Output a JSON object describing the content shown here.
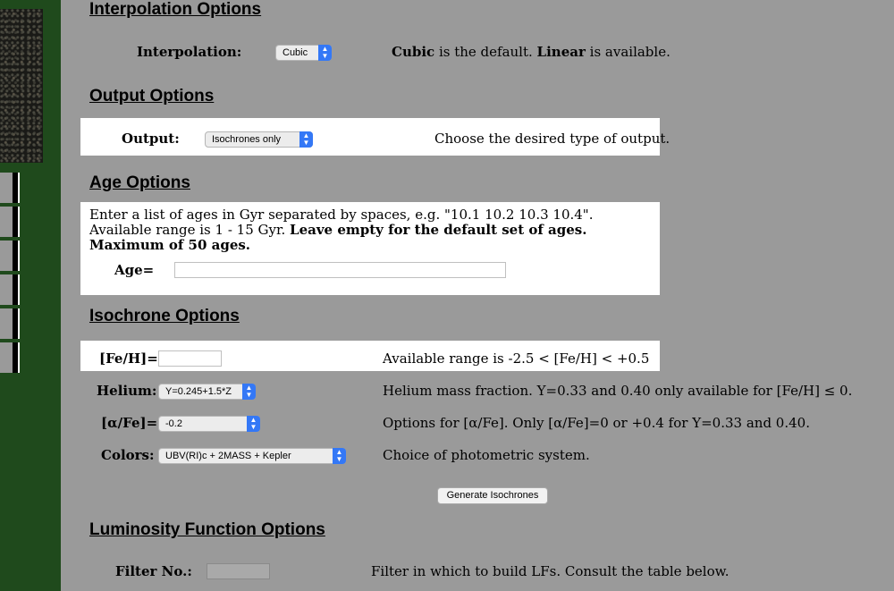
{
  "interpolation": {
    "title": "Interpolation Options",
    "label": "Interpolation:",
    "select_value": "Cubic",
    "desc_part1": "Cubic",
    "desc_part2": " is the default. ",
    "desc_part3": "Linear",
    "desc_part4": " is available."
  },
  "output": {
    "title": "Output Options",
    "label": "Output:",
    "select_value": "Isochrones only",
    "desc": "Choose the desired type of output."
  },
  "age": {
    "title": "Age Options",
    "line1": "Enter a list of ages in Gyr separated by spaces, e.g. \"10.1 10.2 10.3 10.4\".",
    "line2_plain": "Available range is 1 - 15 Gyr. ",
    "line2_bold": "Leave empty for the default set of ages.",
    "line3_bold": "Maximum of 50 ages.",
    "label": "Age=",
    "input_value": ""
  },
  "isochrone": {
    "title": "Isochrone Options",
    "feh_label": "[Fe/H]=",
    "feh_value": "",
    "feh_desc": "Available range is -2.5 < [Fe/H] < +0.5",
    "helium_label": "Helium:",
    "helium_value": "Y=0.245+1.5*Z",
    "helium_desc": "Helium mass fraction. Y=0.33 and 0.40 only available for [Fe/H] ≤ 0.",
    "alpha_label": "[α/Fe]=",
    "alpha_value": "-0.2",
    "alpha_desc": "Options for [α/Fe]. Only [α/Fe]=0 or +0.4 for Y=0.33 and 0.40.",
    "colors_label": "Colors:",
    "colors_value": "UBV(RI)c + 2MASS + Kepler",
    "colors_desc": "Choice of photometric system.",
    "generate_button": "Generate Isochrones"
  },
  "luminosity": {
    "title": "Luminosity Function Options",
    "filter_label": "Filter No.:",
    "filter_value": "",
    "filter_desc": "Filter in which to build LFs. Consult the table below."
  },
  "colors": {
    "background": "#9a9a9a",
    "sidebar_green": "#1f4a1c",
    "select_arrow": "#3478f6"
  }
}
